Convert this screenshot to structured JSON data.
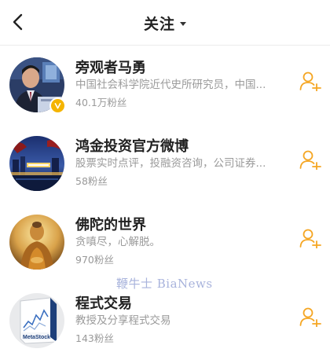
{
  "header": {
    "title": "关注",
    "back_icon": "chevron-left-icon",
    "dropdown_icon": "caret-down-icon"
  },
  "users": [
    {
      "name": "旁观者马勇",
      "bio": "中国社会科学院近代史所研究员，中国...",
      "fans": "40.1万粉丝",
      "verified": true,
      "avatar": "portrait-man-suit",
      "follow_icon": "add-user-icon"
    },
    {
      "name": "鸿金投资官方微博",
      "bio": "股票实时点评，投融资咨询，公司证券...",
      "fans": "58粉丝",
      "verified": false,
      "avatar": "night-city-skyline",
      "follow_icon": "add-user-icon"
    },
    {
      "name": "佛陀的世界",
      "bio": "贪嗔尽，心解脱。",
      "fans": "970粉丝",
      "verified": false,
      "avatar": "golden-buddha",
      "follow_icon": "add-user-icon"
    },
    {
      "name": "程式交易",
      "bio": "教授及分享程式交易",
      "fans": "143粉丝",
      "verified": false,
      "avatar": "metastock-box",
      "avatar_text": "MetaStock",
      "follow_icon": "add-user-icon"
    }
  ],
  "watermark": "鞭牛士 BiaNews",
  "colors": {
    "accent": "#f5a623",
    "verified_badge": "#f4b400",
    "secondary_text": "#9a9a9a",
    "watermark": "#9aa6d6"
  }
}
